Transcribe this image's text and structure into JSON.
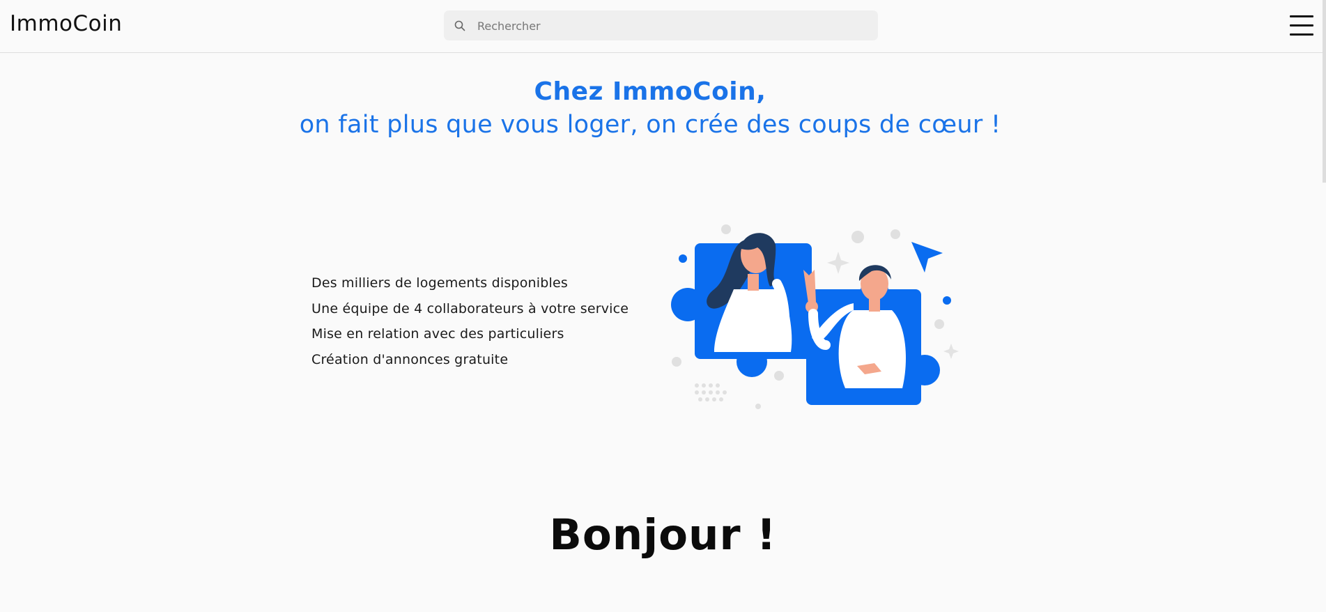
{
  "header": {
    "logo": "ImmoCoin",
    "search_placeholder": "Rechercher",
    "search_icon": "search-icon",
    "menu_icon": "hamburger-menu-icon"
  },
  "hero": {
    "title_line1": "Chez ImmoCoin,",
    "title_line2": "on fait plus que vous loger, on crée des coups de cœur !"
  },
  "features": [
    "Des milliers de logements disponibles",
    "Une équipe de 4 collaborateurs à votre service",
    "Mise en relation avec des particuliers",
    "Création d'annonces gratuite"
  ],
  "greeting": "Bonjour !",
  "colors": {
    "accent": "#1a73e8",
    "illustration_blue": "#0a6cf0",
    "hair": "#1f3a5f",
    "skin": "#f4a78c"
  }
}
